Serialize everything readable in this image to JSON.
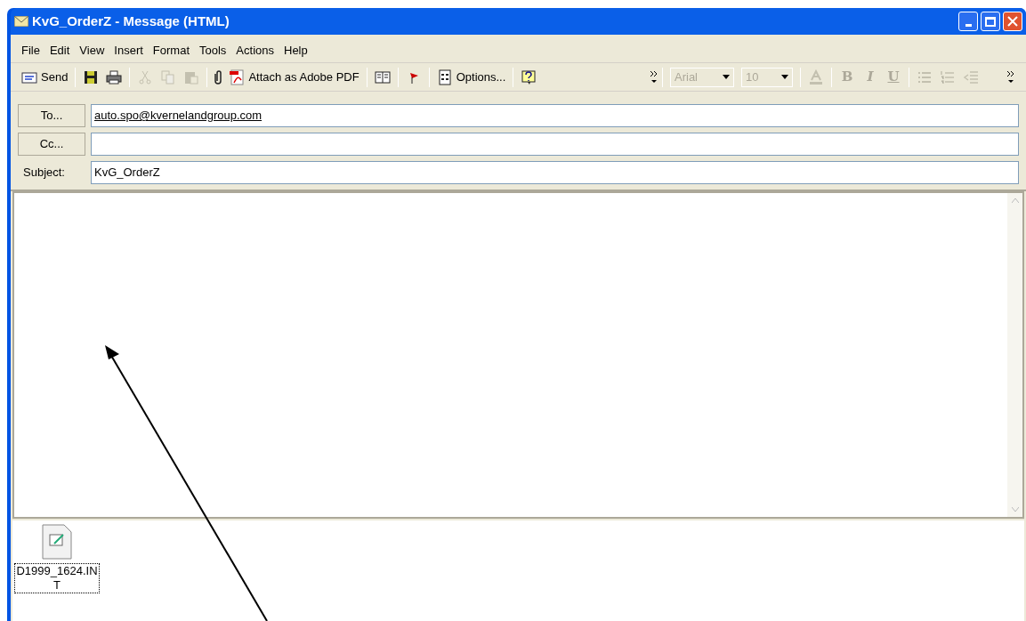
{
  "window": {
    "title": "KvG_OrderZ - Message (HTML)"
  },
  "menu": [
    "File",
    "Edit",
    "View",
    "Insert",
    "Format",
    "Tools",
    "Actions",
    "Help"
  ],
  "toolbar": [
    {
      "kind": "button",
      "label": "Send"
    },
    {
      "kind": "sep"
    },
    {
      "kind": "button"
    },
    {
      "kind": "button"
    },
    {
      "kind": "sep"
    },
    {
      "kind": "button",
      "disabled": true
    },
    {
      "kind": "button",
      "disabled": true
    },
    {
      "kind": "button",
      "disabled": true
    },
    {
      "kind": "sep"
    },
    {
      "kind": "button"
    },
    {
      "kind": "button",
      "label": "Attach as Adobe PDF"
    },
    {
      "kind": "sep"
    },
    {
      "kind": "button"
    },
    {
      "kind": "sep"
    },
    {
      "kind": "button"
    },
    {
      "kind": "sep"
    },
    {
      "kind": "button",
      "label": "Options..."
    },
    {
      "kind": "sep"
    },
    {
      "kind": "button"
    },
    {
      "kind": "more"
    }
  ],
  "format_toolbar": [
    {
      "kind": "combo",
      "value": "Arial",
      "disabled": true
    },
    {
      "kind": "combo",
      "value": "10",
      "disabled": true
    },
    {
      "kind": "sep"
    },
    {
      "kind": "button",
      "disabled": true
    },
    {
      "kind": "sep"
    },
    {
      "kind": "letter",
      "label": "B",
      "disabled": true
    },
    {
      "kind": "letter",
      "label": "I",
      "disabled": true
    },
    {
      "kind": "letter",
      "label": "U",
      "disabled": true
    },
    {
      "kind": "sep"
    },
    {
      "kind": "button",
      "disabled": true
    },
    {
      "kind": "button",
      "disabled": true
    },
    {
      "kind": "button",
      "disabled": true
    },
    {
      "kind": "more"
    }
  ],
  "fields": [
    {
      "kind": "button",
      "label": "To...",
      "value": "auto.spo@kvernelandgroup.com"
    },
    {
      "kind": "button",
      "label": "Cc..."
    },
    {
      "kind": "label",
      "label": "Subject:",
      "value": "KvG_OrderZ"
    }
  ],
  "attachments": [
    {
      "name": "D1999_1624.INT"
    }
  ]
}
